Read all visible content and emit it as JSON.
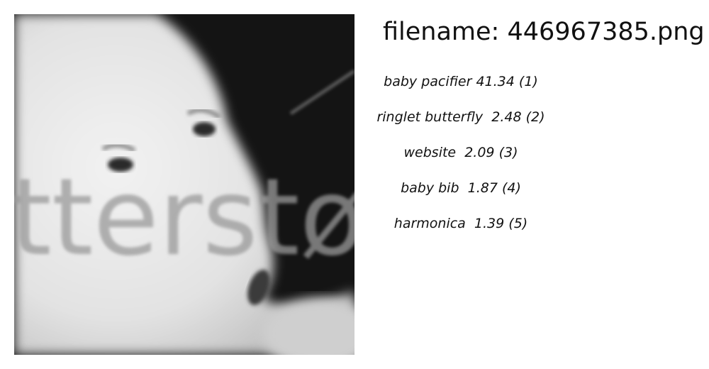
{
  "image": {
    "watermark": "tterstø",
    "colors": {
      "background_dark": "#141414",
      "skin": "#e6e6e6",
      "watermark": "#9a9a9a"
    }
  },
  "title": "filename: 446967385.png",
  "predictions": [
    {
      "label": "baby pacifier",
      "score": "41.34",
      "rank": "(1)"
    },
    {
      "label": "ringlet butterfly",
      "score": "2.48",
      "rank": "(2)"
    },
    {
      "label": "website",
      "score": "2.09",
      "rank": "(3)"
    },
    {
      "label": "baby bib",
      "score": "1.87",
      "rank": "(4)"
    },
    {
      "label": "harmonica",
      "score": "1.39",
      "rank": "(5)"
    }
  ]
}
